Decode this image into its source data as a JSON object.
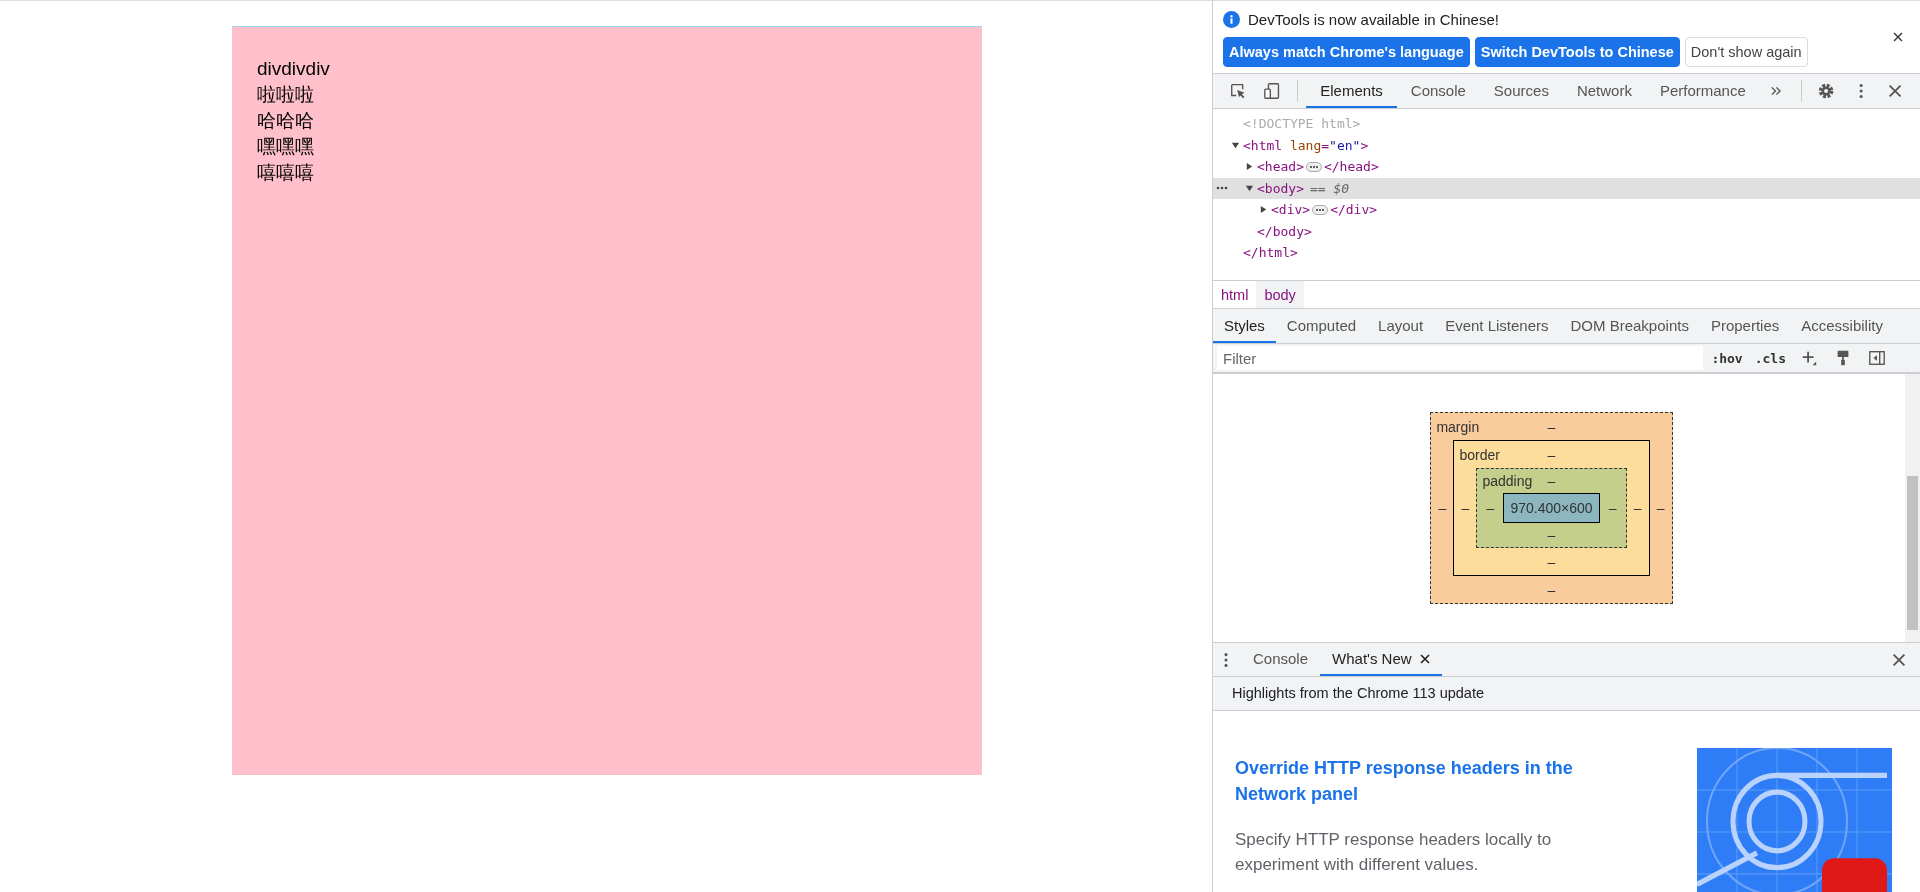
{
  "page": {
    "lines": [
      "divdivdiv",
      "啦啦啦",
      "哈哈哈",
      "嘿嘿嘿",
      "嘻嘻嘻"
    ]
  },
  "infobar": {
    "message": "DevTools is now available in Chinese!",
    "buttons": [
      {
        "label": "Always match Chrome's language",
        "kind": "primary"
      },
      {
        "label": "Switch DevTools to Chinese",
        "kind": "primary"
      },
      {
        "label": "Don't show again",
        "kind": "secondary"
      }
    ]
  },
  "tabs": [
    {
      "label": "Elements",
      "selected": true
    },
    {
      "label": "Console",
      "selected": false
    },
    {
      "label": "Sources",
      "selected": false
    },
    {
      "label": "Network",
      "selected": false
    },
    {
      "label": "Performance",
      "selected": false
    }
  ],
  "dom": [
    {
      "parts": [
        {
          "kind": "doctype",
          "text": "<!DOCTYPE html>"
        }
      ]
    },
    {
      "parts": [
        {
          "kind": "tag",
          "text": "<html "
        },
        {
          "kind": "attr",
          "text": "lang"
        },
        {
          "kind": "tag",
          "text": "="
        },
        {
          "kind": "value",
          "text": "\"en\""
        },
        {
          "kind": "tag",
          "text": ">"
        }
      ],
      "expanded": true,
      "selected": false,
      "children": [
        {
          "parts": [
            {
              "kind": "tag",
              "text": "<head>"
            },
            {
              "kind": "ellipsis"
            },
            {
              "kind": "tag",
              "text": "</head>"
            }
          ],
          "expanded": false,
          "selected": false
        },
        {
          "parts": [
            {
              "kind": "tag",
              "text": "<body>"
            },
            {
              "kind": "note",
              "text": "== $0"
            }
          ],
          "expanded": true,
          "selected": true,
          "children": [
            {
              "parts": [
                {
                  "kind": "tag",
                  "text": "<div>"
                },
                {
                  "kind": "ellipsis"
                },
                {
                  "kind": "tag",
                  "text": "</div>"
                }
              ],
              "expanded": false,
              "selected": false
            }
          ],
          "closing": [
            {
              "kind": "tag",
              "text": "</body>"
            }
          ]
        }
      ],
      "closing": [
        {
          "kind": "tag",
          "text": "</html>"
        }
      ]
    }
  ],
  "breadcrumbs": [
    {
      "label": "html",
      "selected": false
    },
    {
      "label": "body",
      "selected": true
    }
  ],
  "style_tabs": [
    {
      "label": "Styles",
      "selected": true
    },
    {
      "label": "Computed",
      "selected": false
    },
    {
      "label": "Layout",
      "selected": false
    },
    {
      "label": "Event Listeners",
      "selected": false
    },
    {
      "label": "DOM Breakpoints",
      "selected": false
    },
    {
      "label": "Properties",
      "selected": false
    },
    {
      "label": "Accessibility",
      "selected": false
    }
  ],
  "filter": {
    "placeholder": "Filter",
    "toggles": [
      ":hov",
      ".cls"
    ]
  },
  "box_model": {
    "layers": [
      {
        "label": "margin",
        "top": "–"
      },
      {
        "label": "border",
        "top": "–"
      },
      {
        "label": "padding",
        "top": "–"
      }
    ],
    "left_values": [
      "–",
      "–",
      "–"
    ],
    "content": "970.400×600",
    "right_values": [
      "–",
      "–",
      "–"
    ],
    "bottom_values": [
      "–",
      "–",
      "–"
    ]
  },
  "drawer": {
    "tabs": [
      {
        "label": "Console",
        "selected": false,
        "closable": false
      },
      {
        "label": "What's New",
        "selected": true,
        "closable": true
      }
    ],
    "subtitle": "Highlights from the Chrome 113 update",
    "article": {
      "title": "Override HTTP response headers in the Network panel",
      "body": "Specify HTTP response headers locally to experiment with different values."
    }
  }
}
